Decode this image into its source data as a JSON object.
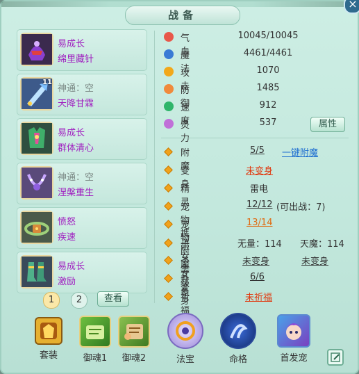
{
  "window": {
    "title": "战备",
    "close_glyph": "×"
  },
  "equipment": [
    {
      "line1": "易成长",
      "line1_color": "#a020c0",
      "line2": "绵里藏针",
      "icon": "helmet-icon"
    },
    {
      "line1": "神通：空",
      "line1_color": "#7c8a86",
      "line2": "天降甘霖",
      "icon": "weapon-icon",
      "badge": "11"
    },
    {
      "line1": "易成长",
      "line1_color": "#a020c0",
      "line2": "群体清心",
      "icon": "armor-icon"
    },
    {
      "line1": "神通：空",
      "line1_color": "#7c8a86",
      "line2": "涅槃重生",
      "icon": "necklace-icon"
    },
    {
      "line1": "愤怒",
      "line1_color": "#a020c0",
      "line2": "疾速",
      "icon": "belt-icon"
    },
    {
      "line1": "易成长",
      "line1_color": "#a020c0",
      "line2": "激励",
      "icon": "boots-icon"
    }
  ],
  "pagination": {
    "page1": "1",
    "page2": "2",
    "view_label": "查看"
  },
  "stats": [
    {
      "label": "气血",
      "value": "10045/10045",
      "icon": "heart-icon",
      "color": "#e8584a"
    },
    {
      "label": "魔法",
      "value": "4461/4461",
      "icon": "mana-icon",
      "color": "#3a7bd5"
    },
    {
      "label": "攻击",
      "value": "1070",
      "icon": "attack-icon",
      "color": "#f2a81a"
    },
    {
      "label": "防御",
      "value": "1485",
      "icon": "defense-icon",
      "color": "#f08a3c"
    },
    {
      "label": "速度",
      "value": "912",
      "icon": "speed-icon",
      "color": "#2fb56a"
    },
    {
      "label": "灵力",
      "value": "537",
      "icon": "spirit-icon",
      "color": "#c070d8"
    }
  ],
  "attr_button": "属性",
  "info": {
    "fumo": {
      "label": "附魔",
      "value": "5/5",
      "link": "一键附魔"
    },
    "bianshen": {
      "label": "变身",
      "value": "未变身"
    },
    "jingling": {
      "label": "精灵",
      "value": "雷电"
    },
    "pet_carry": {
      "label": "宠物携带",
      "value": "12/12",
      "extra": "(可出战：7)"
    },
    "pet_enchant": {
      "label": "宠物附魔",
      "value": "13/14"
    },
    "child_level": {
      "label": "子女等级",
      "value1": "无量：114",
      "value2": "天魔：114"
    },
    "child_transform": {
      "label": "子女变身",
      "value1": "未变身",
      "value2": "未变身"
    },
    "guaxiang": {
      "label": "卦象",
      "value": "6/6"
    },
    "qifu": {
      "label": "祈福",
      "value": "未祈福"
    }
  },
  "bottom_tabs": [
    {
      "label": "套装",
      "icon": "suit-icon"
    },
    {
      "label": "御魂1",
      "icon": "soul1-icon"
    },
    {
      "label": "御魂2",
      "icon": "soul2-icon"
    },
    {
      "label": "法宝",
      "icon": "treasure-icon"
    },
    {
      "label": "命格",
      "icon": "fate-icon"
    },
    {
      "label": "首发宠",
      "icon": "pet-icon"
    }
  ]
}
